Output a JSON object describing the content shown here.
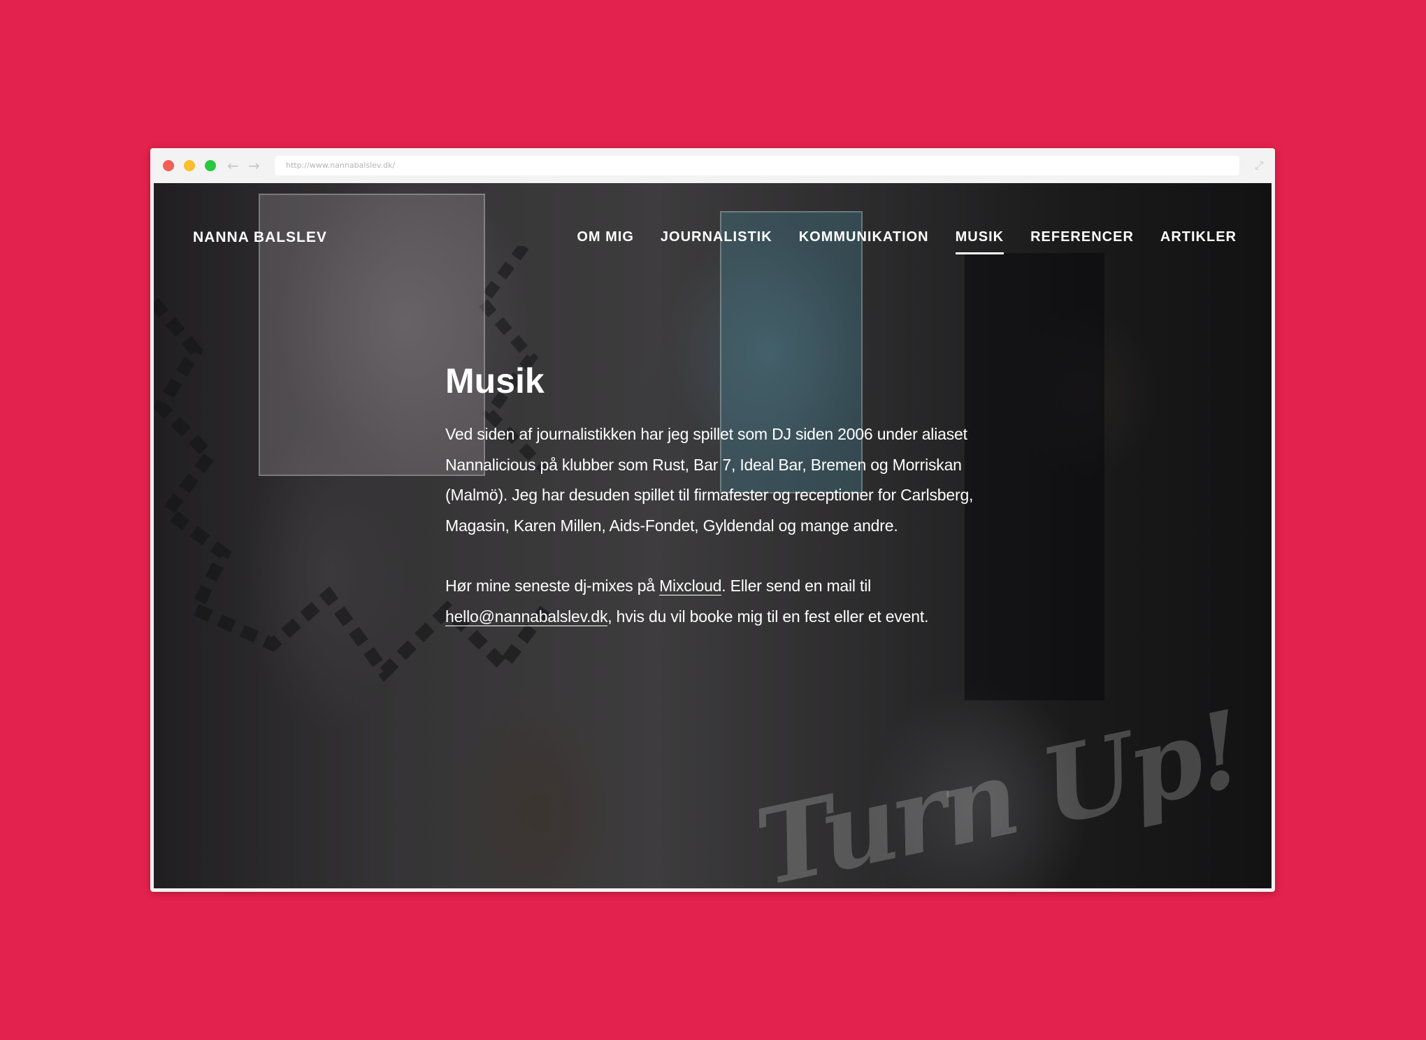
{
  "browser": {
    "url": "http://www.nannabalslev.dk/",
    "back_icon": "arrow-left-icon",
    "forward_icon": "arrow-right-icon",
    "expand_icon": "expand-icon"
  },
  "site": {
    "logo": "NANNA BALSLEV",
    "nav": [
      {
        "label": "OM MIG"
      },
      {
        "label": "JOURNALISTIK"
      },
      {
        "label": "KOMMUNIKATION"
      },
      {
        "label": "MUSIK",
        "active": true
      },
      {
        "label": "REFERENCER"
      },
      {
        "label": "ARTIKLER"
      }
    ]
  },
  "page": {
    "title": "Musik",
    "paragraph1": "Ved siden af journalistikken har jeg spillet som DJ siden 2006 under aliaset Nannalicious på klubber som Rust, Bar 7, Ideal Bar, Bremen og Morriskan (Malmö). Jeg har desuden spillet til firmafester og receptioner for Carlsberg, Magasin, Karen Millen, Aids-Fondet, Gyldendal og mange andre.",
    "paragraph2": {
      "before_link1": "Hør mine seneste dj-mixes på ",
      "link1": "Mixcloud",
      "between": ". Eller send en mail til ",
      "link2": "hello@nannabalslev.dk",
      "after": ", hvis du vil booke mig til en fest eller et event."
    }
  },
  "background": {
    "overlay_text": "Turn Up!"
  },
  "colors": {
    "page_background": "#e3224d",
    "text": "#ffffff",
    "traffic_red": "#f25f58",
    "traffic_yellow": "#fbbe2e",
    "traffic_green": "#28c840"
  }
}
